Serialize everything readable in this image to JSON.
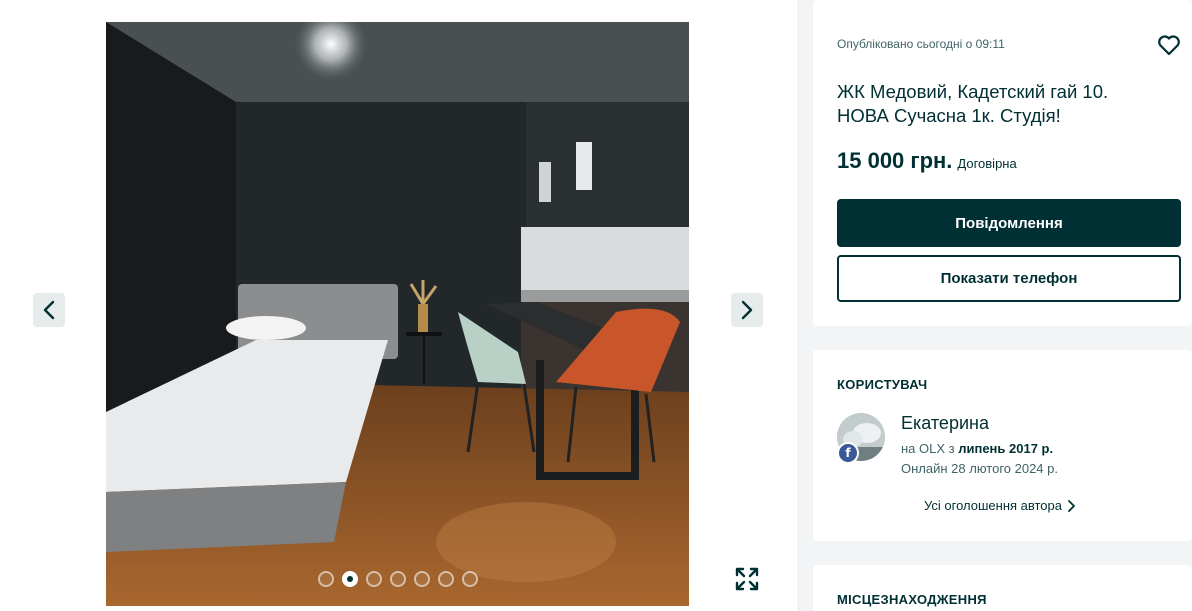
{
  "gallery": {
    "photo_alt": "",
    "slides": [
      {
        "active": false
      },
      {
        "active": true
      },
      {
        "active": false
      },
      {
        "active": false
      },
      {
        "active": false
      },
      {
        "active": false
      },
      {
        "active": false
      }
    ],
    "icons": {
      "prev": "chevron-left-icon",
      "next": "chevron-right-icon",
      "fullscreen": "expand-icon"
    }
  },
  "listing": {
    "published": "Опубліковано сьогодні о 09:11",
    "title": "ЖК Медовий, Кадетский гай 10. НОВА Сучасна 1к. Студія!",
    "price": "15 000 грн.",
    "negotiable": "Договірна",
    "message_button": "Повідомлення",
    "phone_button": "Показати телефон",
    "favorite_icon": "heart-icon"
  },
  "user": {
    "section_title": "КОРИСТУВАЧ",
    "name": "Екатерина",
    "since_prefix": "на OLX з ",
    "since_date": "липень 2017 р.",
    "online": "Онлайн 28 лютого 2024 р.",
    "all_ads": "Усі оголошення автора",
    "badge": "f"
  },
  "location": {
    "section_title": "МІСЦЕЗНАХОДЖЕННЯ"
  },
  "colors": {
    "brand": "#002f34",
    "page_bg": "#f2f4f5",
    "facebook": "#3b5998"
  }
}
